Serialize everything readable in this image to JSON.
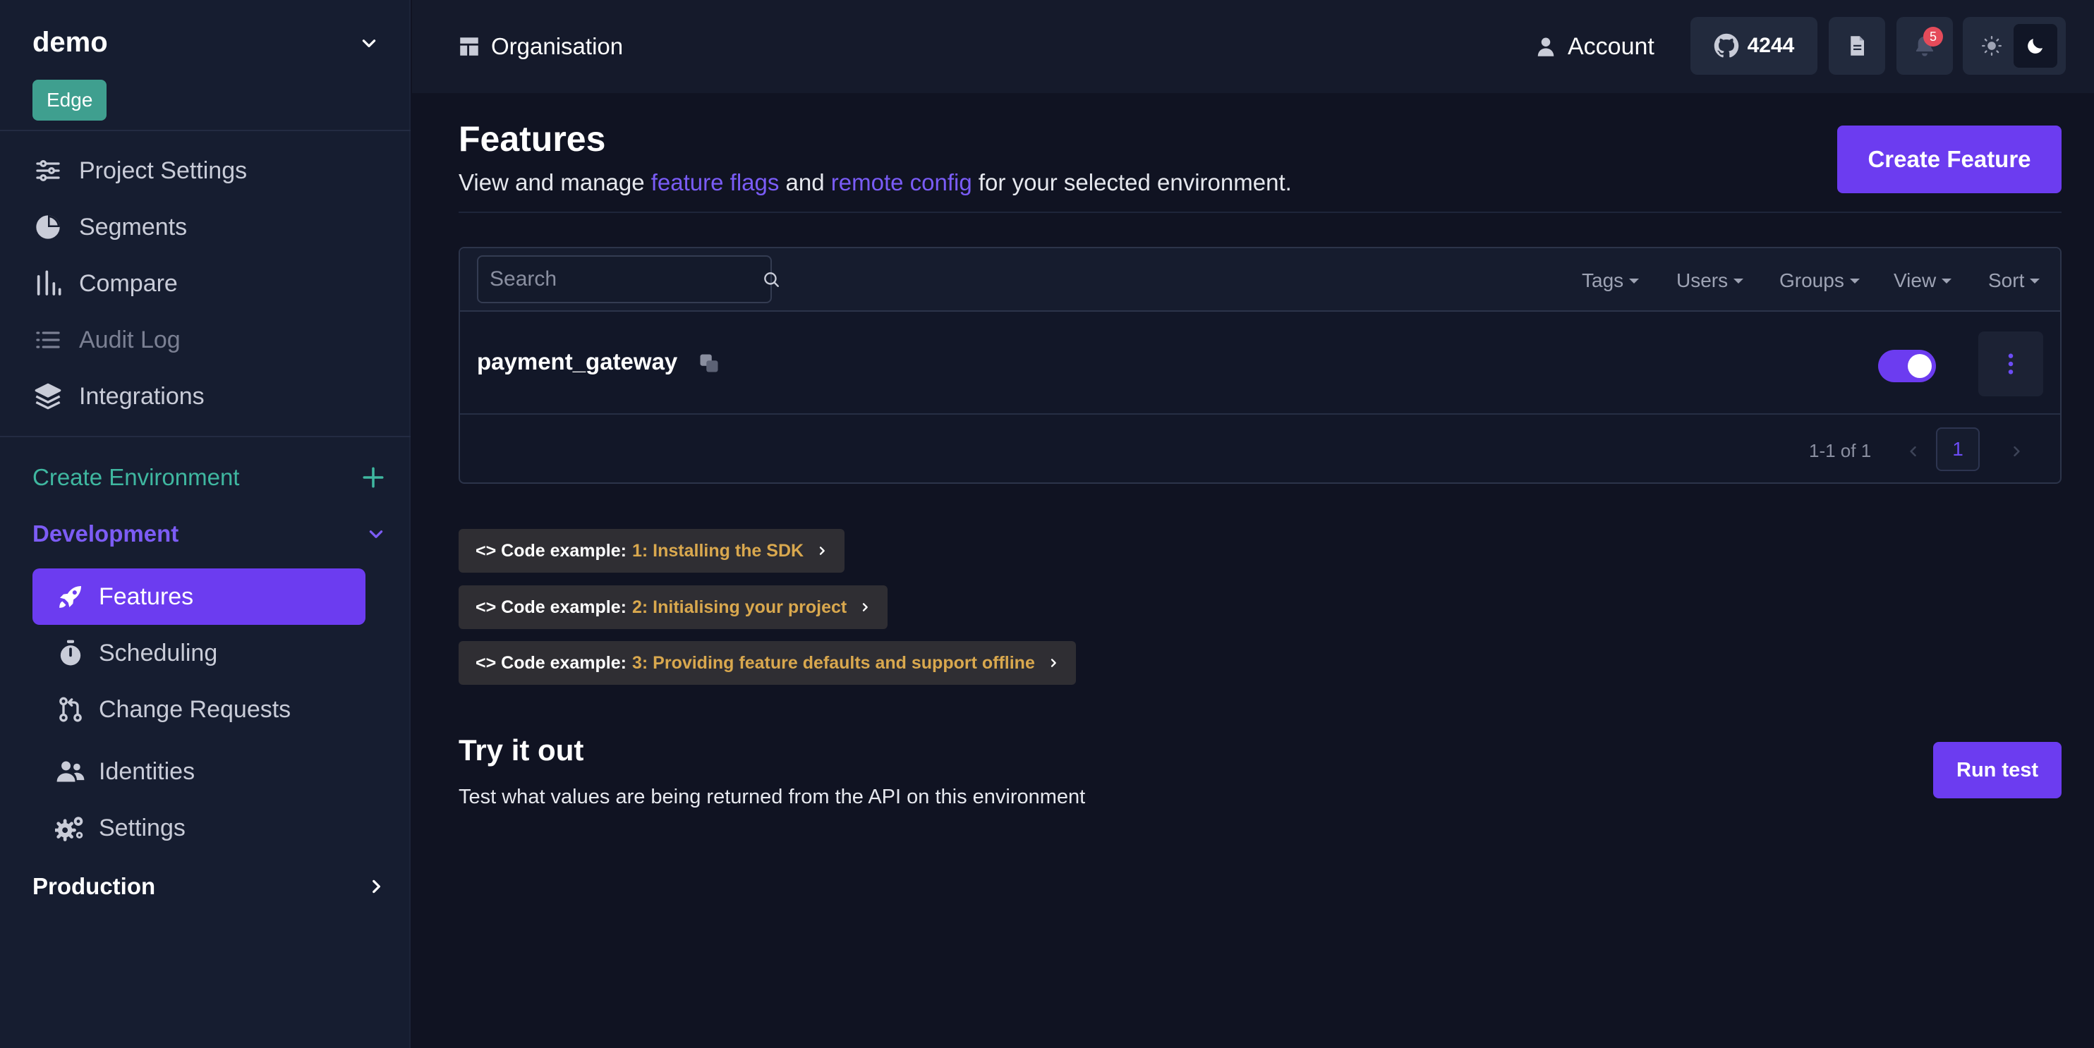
{
  "project": {
    "name": "demo",
    "badge": "Edge"
  },
  "sidebar": {
    "items": [
      {
        "label": "Project Settings",
        "icon": "sliders-icon"
      },
      {
        "label": "Segments",
        "icon": "pie-chart-icon"
      },
      {
        "label": "Compare",
        "icon": "bar-chart-icon"
      },
      {
        "label": "Audit Log",
        "icon": "list-icon"
      },
      {
        "label": "Integrations",
        "icon": "layers-icon"
      }
    ],
    "create_environment": "Create Environment",
    "current_environment": "Development",
    "environment_items": [
      {
        "label": "Features",
        "icon": "rocket-icon"
      },
      {
        "label": "Scheduling",
        "icon": "stopwatch-icon"
      },
      {
        "label": "Change Requests",
        "icon": "git-pull-request-icon"
      },
      {
        "label": "Identities",
        "icon": "users-icon"
      },
      {
        "label": "Settings",
        "icon": "gears-icon"
      }
    ],
    "other_environment": "Production"
  },
  "topbar": {
    "breadcrumb": "Organisation",
    "account": "Account",
    "github_stars": "4244",
    "notification_count": "5"
  },
  "main": {
    "title": "Features",
    "subtitle_before": "View and manage ",
    "link_flags": "feature flags",
    "subtitle_and": " and ",
    "link_remote": "remote config",
    "subtitle_after": " for your selected environment.",
    "create_button": "Create Feature",
    "search_placeholder": "Search",
    "filters": [
      "Tags",
      "Users",
      "Groups",
      "View",
      "Sort"
    ],
    "features": [
      {
        "name": "payment_gateway",
        "enabled": true
      }
    ],
    "pagination": {
      "range": "1-1 of 1",
      "current_page": "1"
    },
    "code_examples": [
      {
        "prefix": "<> Code example:",
        "step": "1: Installing the SDK"
      },
      {
        "prefix": "<> Code example:",
        "step": "2: Initialising your project"
      },
      {
        "prefix": "<> Code example:",
        "step": "3: Providing feature defaults and support offline"
      }
    ],
    "try_title": "Try it out",
    "try_subtitle": "Test what values are being returned from the API on this environment",
    "run_button": "Run test"
  },
  "colors": {
    "accent": "#6c3cf0",
    "teal": "#3f9f8f",
    "link": "#7a5cf7",
    "code_step": "#d9a84e"
  }
}
